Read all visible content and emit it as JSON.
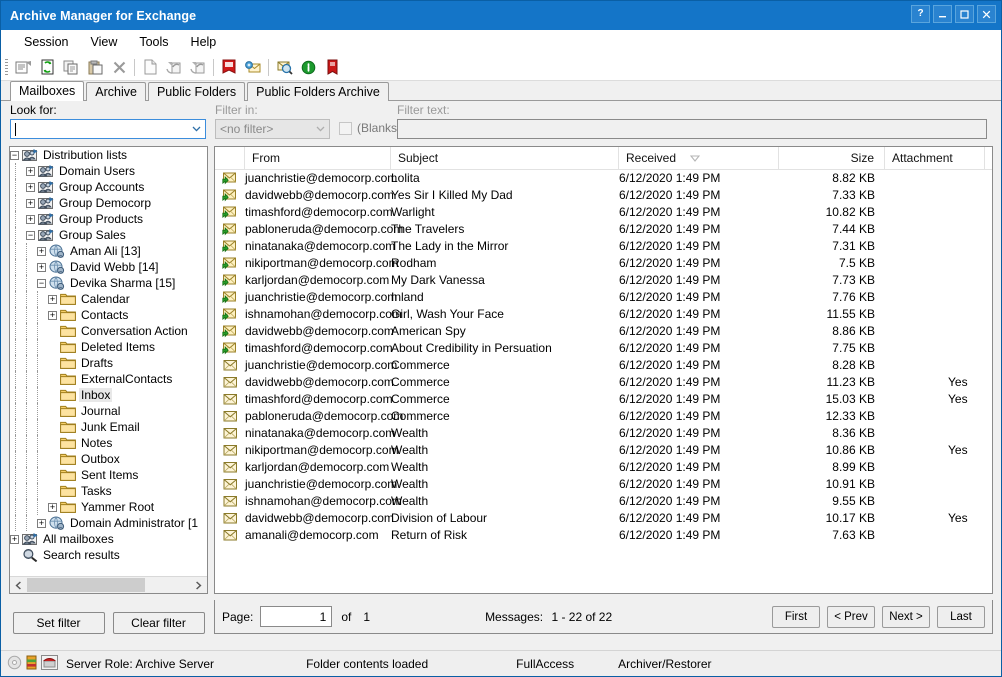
{
  "window": {
    "title": "Archive Manager for Exchange",
    "buttons": [
      {
        "name": "help-button",
        "glyph": "?"
      },
      {
        "name": "minimize-button",
        "glyph": "–"
      },
      {
        "name": "maximize-button",
        "glyph": "□"
      },
      {
        "name": "close-button",
        "glyph": "✕"
      }
    ]
  },
  "menu": {
    "items": [
      {
        "label": "Session"
      },
      {
        "label": "View"
      },
      {
        "label": "Tools"
      },
      {
        "label": "Help"
      }
    ]
  },
  "toolbar": {
    "buttons": [
      {
        "icon": "properties-icon"
      },
      {
        "icon": "refresh-icon"
      },
      {
        "icon": "copy-icon"
      },
      {
        "icon": "paste-icon"
      },
      {
        "icon": "delete-icon"
      },
      {
        "sep": true
      },
      {
        "icon": "new-document-icon"
      },
      {
        "icon": "restore-icon"
      },
      {
        "icon": "restore-all-icon"
      },
      {
        "sep": true
      },
      {
        "icon": "archive-icon"
      },
      {
        "icon": "mail-archive-icon"
      },
      {
        "sep": true
      },
      {
        "icon": "search-icon"
      },
      {
        "icon": "info-icon"
      },
      {
        "icon": "shortcut-icon"
      }
    ]
  },
  "tabs": [
    {
      "label": "Mailboxes",
      "active": true
    },
    {
      "label": "Archive",
      "active": false
    },
    {
      "label": "Public Folders",
      "active": false
    },
    {
      "label": "Public Folders Archive",
      "active": false
    }
  ],
  "filter": {
    "look_for_label": "Look for:",
    "look_for_value": "",
    "filter_in_label": "Filter in:",
    "filter_in_value": "<no filter>",
    "blanks_label": "(Blanks)",
    "blanks_checked": false,
    "filter_text_label": "Filter text:",
    "filter_text_value": "",
    "set_filter_label": "Set filter",
    "clear_filter_label": "Clear filter"
  },
  "tree": {
    "nodes": [
      {
        "label": "Distribution lists",
        "depth": 0,
        "toggle": "-",
        "icon": "group-icon",
        "selected": false
      },
      {
        "label": "Domain Users",
        "depth": 1,
        "toggle": "+",
        "icon": "group-icon",
        "selected": false
      },
      {
        "label": "Group Accounts",
        "depth": 1,
        "toggle": "+",
        "icon": "group-icon",
        "selected": false
      },
      {
        "label": "Group Democorp",
        "depth": 1,
        "toggle": "+",
        "icon": "group-icon",
        "selected": false
      },
      {
        "label": "Group Products",
        "depth": 1,
        "toggle": "+",
        "icon": "group-icon",
        "selected": false
      },
      {
        "label": "Group Sales",
        "depth": 1,
        "toggle": "-",
        "icon": "group-icon",
        "selected": false
      },
      {
        "label": "Aman Ali [13]",
        "depth": 2,
        "toggle": "+",
        "icon": "mailbox-icon",
        "selected": false
      },
      {
        "label": "David Webb [14]",
        "depth": 2,
        "toggle": "+",
        "icon": "mailbox-icon",
        "selected": false
      },
      {
        "label": "Devika Sharma [15]",
        "depth": 2,
        "toggle": "-",
        "icon": "mailbox-icon",
        "selected": false
      },
      {
        "label": "Calendar",
        "depth": 3,
        "toggle": "+",
        "icon": "folder-icon",
        "selected": false
      },
      {
        "label": "Contacts",
        "depth": 3,
        "toggle": "+",
        "icon": "folder-icon",
        "selected": false
      },
      {
        "label": "Conversation Action",
        "depth": 3,
        "toggle": "",
        "icon": "folder-icon",
        "selected": false
      },
      {
        "label": "Deleted Items",
        "depth": 3,
        "toggle": "",
        "icon": "folder-icon",
        "selected": false
      },
      {
        "label": "Drafts",
        "depth": 3,
        "toggle": "",
        "icon": "folder-icon",
        "selected": false
      },
      {
        "label": "ExternalContacts",
        "depth": 3,
        "toggle": "",
        "icon": "folder-icon",
        "selected": false
      },
      {
        "label": "Inbox",
        "depth": 3,
        "toggle": "",
        "icon": "folder-icon",
        "selected": true
      },
      {
        "label": "Journal",
        "depth": 3,
        "toggle": "",
        "icon": "folder-icon",
        "selected": false
      },
      {
        "label": "Junk Email",
        "depth": 3,
        "toggle": "",
        "icon": "folder-icon",
        "selected": false
      },
      {
        "label": "Notes",
        "depth": 3,
        "toggle": "",
        "icon": "folder-icon",
        "selected": false
      },
      {
        "label": "Outbox",
        "depth": 3,
        "toggle": "",
        "icon": "folder-icon",
        "selected": false
      },
      {
        "label": "Sent Items",
        "depth": 3,
        "toggle": "",
        "icon": "folder-icon",
        "selected": false
      },
      {
        "label": "Tasks",
        "depth": 3,
        "toggle": "",
        "icon": "folder-icon",
        "selected": false
      },
      {
        "label": "Yammer Root",
        "depth": 3,
        "toggle": "+",
        "icon": "folder-icon",
        "selected": false
      },
      {
        "label": "Domain Administrator [1",
        "depth": 2,
        "toggle": "+",
        "icon": "mailbox-icon",
        "selected": false
      },
      {
        "label": "All mailboxes",
        "depth": 0,
        "toggle": "+",
        "icon": "group-icon",
        "selected": false
      },
      {
        "label": "Search results",
        "depth": 0,
        "toggle": "",
        "icon": "search-results-icon",
        "selected": false
      }
    ]
  },
  "list": {
    "columns": [
      {
        "label": "",
        "key": "icon"
      },
      {
        "label": "From",
        "key": "from"
      },
      {
        "label": "Subject",
        "key": "subject"
      },
      {
        "label": "Received",
        "key": "received",
        "sort": "desc"
      },
      {
        "label": "Size",
        "key": "size"
      },
      {
        "label": "Attachment",
        "key": "attachment"
      }
    ],
    "rows": [
      {
        "icon": "archived-mail-icon",
        "from": "juanchristie@democorp.com",
        "subject": "Lolita",
        "received": "6/12/2020 1:49 PM",
        "size": "8.82 KB",
        "attachment": ""
      },
      {
        "icon": "archived-mail-icon",
        "from": "davidwebb@democorp.com",
        "subject": "Yes Sir I Killed My Dad",
        "received": "6/12/2020 1:49 PM",
        "size": "7.33 KB",
        "attachment": ""
      },
      {
        "icon": "archived-mail-icon",
        "from": "timashford@democorp.com",
        "subject": "Warlight",
        "received": "6/12/2020 1:49 PM",
        "size": "10.82 KB",
        "attachment": ""
      },
      {
        "icon": "archived-mail-icon",
        "from": "pabloneruda@democorp.com",
        "subject": "The Travelers",
        "received": "6/12/2020 1:49 PM",
        "size": "7.44 KB",
        "attachment": ""
      },
      {
        "icon": "archived-mail-icon",
        "from": "ninatanaka@democorp.com",
        "subject": "The Lady in the Mirror",
        "received": "6/12/2020 1:49 PM",
        "size": "7.31 KB",
        "attachment": ""
      },
      {
        "icon": "archived-mail-icon",
        "from": "nikiportman@democorp.com",
        "subject": "Rodham",
        "received": "6/12/2020 1:49 PM",
        "size": "7.5 KB",
        "attachment": ""
      },
      {
        "icon": "archived-mail-icon",
        "from": "karljordan@democorp.com",
        "subject": "My Dark Vanessa",
        "received": "6/12/2020 1:49 PM",
        "size": "7.73 KB",
        "attachment": ""
      },
      {
        "icon": "archived-mail-icon",
        "from": "juanchristie@democorp.com",
        "subject": "Inland",
        "received": "6/12/2020 1:49 PM",
        "size": "7.76 KB",
        "attachment": ""
      },
      {
        "icon": "archived-mail-icon",
        "from": "ishnamohan@democorp.com",
        "subject": "Girl, Wash Your Face",
        "received": "6/12/2020 1:49 PM",
        "size": "11.55 KB",
        "attachment": ""
      },
      {
        "icon": "archived-mail-icon",
        "from": "davidwebb@democorp.com",
        "subject": "American Spy",
        "received": "6/12/2020 1:49 PM",
        "size": "8.86 KB",
        "attachment": ""
      },
      {
        "icon": "archived-mail-icon",
        "from": "timashford@democorp.com",
        "subject": "About Credibility in Persuation",
        "received": "6/12/2020 1:49 PM",
        "size": "7.75 KB",
        "attachment": ""
      },
      {
        "icon": "mail-icon",
        "from": "juanchristie@democorp.com",
        "subject": "Commerce",
        "received": "6/12/2020 1:49 PM",
        "size": "8.28 KB",
        "attachment": ""
      },
      {
        "icon": "mail-icon",
        "from": "davidwebb@democorp.com",
        "subject": "Commerce",
        "received": "6/12/2020 1:49 PM",
        "size": "11.23 KB",
        "attachment": "Yes"
      },
      {
        "icon": "mail-icon",
        "from": "timashford@democorp.com",
        "subject": "Commerce",
        "received": "6/12/2020 1:49 PM",
        "size": "15.03 KB",
        "attachment": "Yes"
      },
      {
        "icon": "mail-icon",
        "from": "pabloneruda@democorp.com",
        "subject": "Commerce",
        "received": "6/12/2020 1:49 PM",
        "size": "12.33 KB",
        "attachment": ""
      },
      {
        "icon": "mail-icon",
        "from": "ninatanaka@democorp.com",
        "subject": "Wealth",
        "received": "6/12/2020 1:49 PM",
        "size": "8.36 KB",
        "attachment": ""
      },
      {
        "icon": "mail-icon",
        "from": "nikiportman@democorp.com",
        "subject": "Wealth",
        "received": "6/12/2020 1:49 PM",
        "size": "10.86 KB",
        "attachment": "Yes"
      },
      {
        "icon": "mail-icon",
        "from": "karljordan@democorp.com",
        "subject": "Wealth",
        "received": "6/12/2020 1:49 PM",
        "size": "8.99 KB",
        "attachment": ""
      },
      {
        "icon": "mail-icon",
        "from": "juanchristie@democorp.com",
        "subject": "Wealth",
        "received": "6/12/2020 1:49 PM",
        "size": "10.91 KB",
        "attachment": ""
      },
      {
        "icon": "mail-icon",
        "from": "ishnamohan@democorp.com",
        "subject": "Wealth",
        "received": "6/12/2020 1:49 PM",
        "size": "9.55 KB",
        "attachment": ""
      },
      {
        "icon": "mail-icon",
        "from": "davidwebb@democorp.com",
        "subject": "Division of Labour",
        "received": "6/12/2020 1:49 PM",
        "size": "10.17 KB",
        "attachment": "Yes"
      },
      {
        "icon": "mail-icon",
        "from": "amanali@democorp.com",
        "subject": "Return of Risk",
        "received": "6/12/2020 1:49 PM",
        "size": "7.63 KB",
        "attachment": ""
      }
    ]
  },
  "pager": {
    "page_label": "Page:",
    "page_value": "1",
    "of_label": "of",
    "page_total": "1",
    "messages_label": "Messages:",
    "messages_value": "1 - 22 of 22",
    "buttons": [
      {
        "label": "First",
        "name": "first-page-button"
      },
      {
        "label": "< Prev",
        "name": "prev-page-button"
      },
      {
        "label": "Next >",
        "name": "next-page-button"
      },
      {
        "label": "Last",
        "name": "last-page-button"
      }
    ]
  },
  "status": {
    "server_role": "Server Role: Archive Server",
    "operation": "Folder contents loaded",
    "access": "FullAccess",
    "role": "Archiver/Restorer"
  },
  "colors": {
    "titlebar": "#1475c8",
    "accent": "#3c8ddc",
    "chrome": "#f0f0f0"
  }
}
